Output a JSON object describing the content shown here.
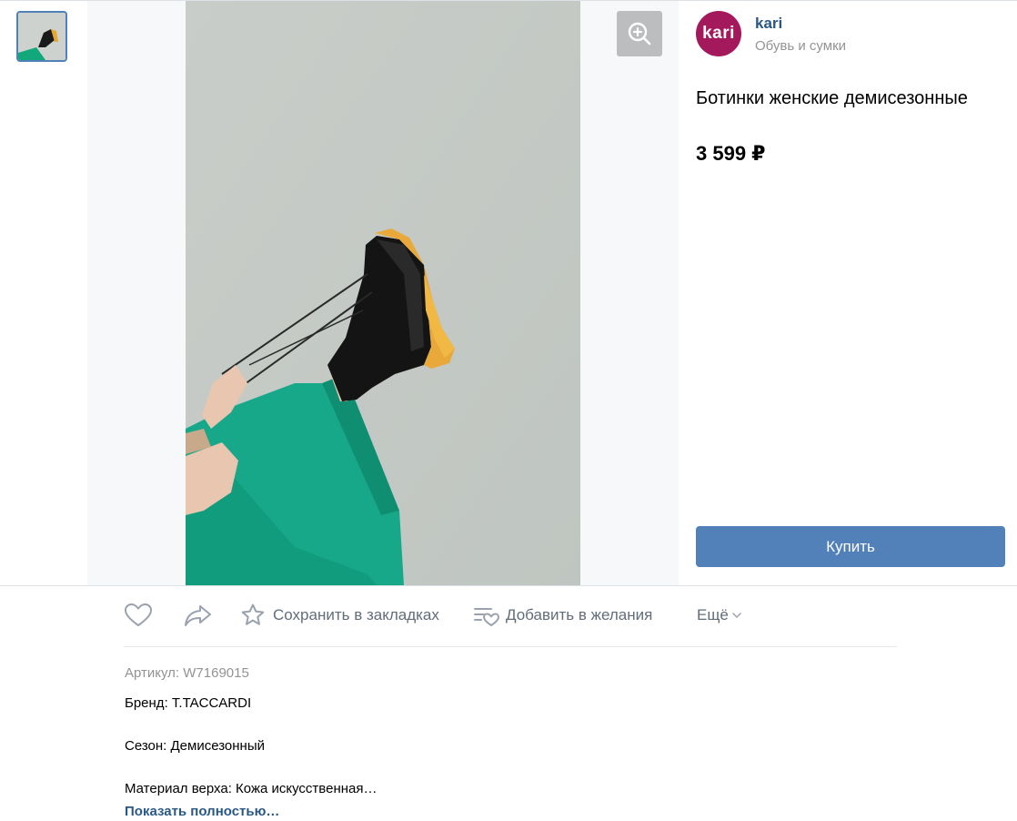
{
  "shop": {
    "name": "kari",
    "category": "Обувь и сумки",
    "logo_text": "kari"
  },
  "product": {
    "title": "Ботинки женские демисезонные",
    "price": "3 599 ₽",
    "buy_label": "Купить",
    "article": "Артикул: W7169015",
    "brand": "Бренд: T.TACCARDI",
    "season": "Сезон: Демисезонный",
    "material": "Материал верха: Кожа искусственная…",
    "show_more": "Показать полностью…"
  },
  "actions": {
    "bookmark_label": "Сохранить в закладках",
    "wishlist_label": "Добавить в желания",
    "more_label": "Ещё"
  },
  "colors": {
    "accent": "#5181b8",
    "link": "#2a5885",
    "brand": "#a3195b",
    "muted": "#939393"
  },
  "icons": [
    "thumbnail-image",
    "zoom-in-icon",
    "heart-icon",
    "share-icon",
    "star-icon",
    "wishlist-icon",
    "chevron-down-icon"
  ]
}
